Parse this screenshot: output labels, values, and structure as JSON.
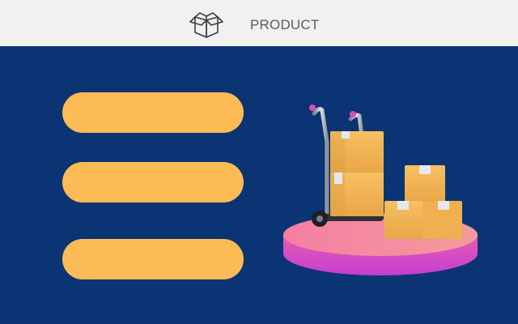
{
  "header": {
    "title": "PRODUCT",
    "icon": "open-box-icon"
  },
  "menu": {
    "items": [
      {
        "label": ""
      },
      {
        "label": ""
      },
      {
        "label": ""
      }
    ],
    "color": "#fdbb55"
  },
  "illustration": {
    "icon": "hand-truck-with-boxes-illustration"
  },
  "colors": {
    "background": "#0a3473",
    "header_background": "#f1f1f0",
    "box": "#f2b451",
    "platform": "#f06fa0"
  }
}
